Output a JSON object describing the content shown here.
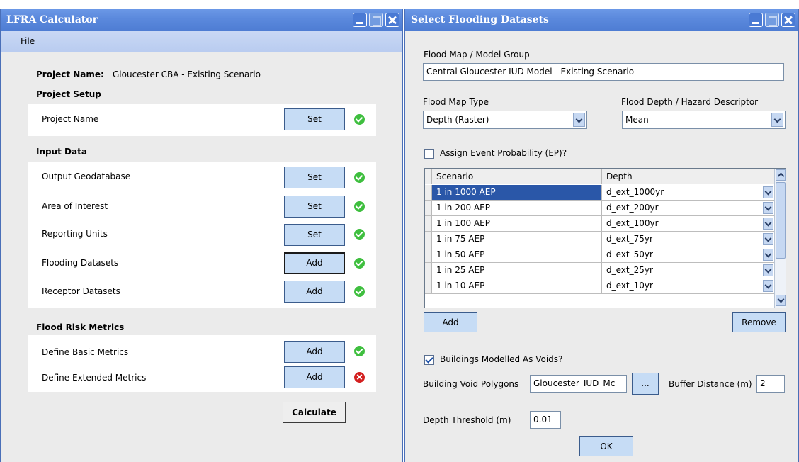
{
  "left": {
    "title": "LFRA Calculator",
    "menu_file": "File",
    "project_name_label": "Project Name:",
    "project_name_value": "Gloucester CBA - Existing Scenario",
    "setup_heading": "Project Setup",
    "setup_items": [
      {
        "label": "Project Name",
        "button": "Set",
        "status": "ok"
      }
    ],
    "input_heading": "Input Data",
    "input_items": [
      {
        "label": "Output Geodatabase",
        "button": "Set",
        "status": "ok"
      },
      {
        "label": "Area of Interest",
        "button": "Set",
        "status": "ok"
      },
      {
        "label": "Reporting Units",
        "button": "Set",
        "status": "ok"
      },
      {
        "label": "Flooding Datasets",
        "button": "Add",
        "status": "ok"
      },
      {
        "label": "Receptor Datasets",
        "button": "Add",
        "status": "ok"
      }
    ],
    "metrics_heading": "Flood Risk Metrics",
    "metrics_items": [
      {
        "label": "Define Basic Metrics",
        "button": "Add",
        "status": "ok"
      },
      {
        "label": "Define Extended Metrics",
        "button": "Add",
        "status": "error"
      }
    ],
    "calculate": "Calculate"
  },
  "right": {
    "title": "Select Flooding Datasets",
    "group_label": "Flood Map / Model Group",
    "group_value": "Central Gloucester IUD Model - Existing Scenario",
    "map_type_label": "Flood Map Type",
    "map_type_value": "Depth (Raster)",
    "descriptor_label": "Flood Depth / Hazard Descriptor",
    "descriptor_value": "Mean",
    "assign_ep_label": "Assign Event Probability (EP)?",
    "assign_ep_checked": false,
    "table": {
      "headers": [
        "Scenario",
        "Depth"
      ],
      "rows": [
        [
          "1 in 1000 AEP",
          "d_ext_1000yr"
        ],
        [
          "1 in 200 AEP",
          "d_ext_200yr"
        ],
        [
          "1 in 100 AEP",
          "d_ext_100yr"
        ],
        [
          "1 in 75 AEP",
          "d_ext_75yr"
        ],
        [
          "1 in 50 AEP",
          "d_ext_50yr"
        ],
        [
          "1 in 25 AEP",
          "d_ext_25yr"
        ],
        [
          "1 in 10 AEP",
          "d_ext_10yr"
        ]
      ],
      "selected_row": 0
    },
    "add": "Add",
    "remove": "Remove",
    "voids_label": "Buildings Modelled As Voids?",
    "voids_checked": true,
    "void_polygons_label": "Building Void Polygons",
    "void_polygons_value": "Gloucester_IUD_Mc",
    "browse": "...",
    "buffer_label": "Buffer Distance (m)",
    "buffer_value": "2",
    "depth_threshold_label": "Depth Threshold (m)",
    "depth_threshold_value": "0.01",
    "ok": "OK"
  }
}
